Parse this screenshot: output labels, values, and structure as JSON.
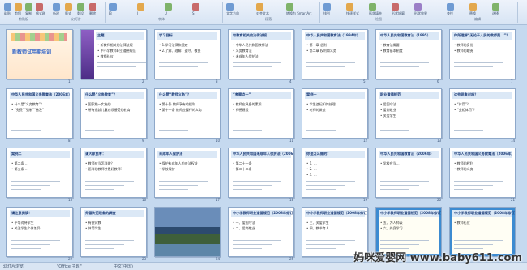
{
  "ribbon": {
    "groups": [
      {
        "label": "剪贴板",
        "buttons": [
          "粘贴",
          "剪切",
          "复制",
          "格式刷"
        ]
      },
      {
        "label": "幻灯片",
        "buttons": [
          "新建",
          "版式",
          "重设",
          "删除"
        ]
      },
      {
        "label": "字体",
        "buttons": [
          "B",
          "I",
          "U",
          "S"
        ]
      },
      {
        "label": "段落",
        "buttons": [
          "文字方向",
          "对齐文本",
          "转换为 SmartArt"
        ]
      },
      {
        "label": "绘图",
        "buttons": [
          "排列",
          "快速样式",
          "形状填充",
          "形状轮廓",
          "形状效果"
        ]
      },
      {
        "label": "编辑",
        "buttons": [
          "查找",
          "替换",
          "选择"
        ]
      }
    ]
  },
  "slides": [
    {
      "n": 1,
      "title": "新教师试用期培训",
      "type": "cover"
    },
    {
      "n": 2,
      "title": "主题",
      "bullets": [
        "新教师相关的法律法规",
        "中小学教师职业道德规范",
        "教师礼仪"
      ],
      "type": "purple"
    },
    {
      "n": 3,
      "title": "学习目标",
      "bullets": [
        "1.学习法律和规定",
        "2.了解、理解、遵守、敬畏"
      ]
    },
    {
      "n": 4,
      "title": "和教育相关的法律法规",
      "bullets": [
        "中华人民共和国教师法",
        "义务教育法",
        "未成年人保护法"
      ]
    },
    {
      "n": 5,
      "title": "中华人民共和国教育法（1994年）",
      "bullets": [
        "第一章 总则",
        "第二章 权利和义务"
      ]
    },
    {
      "n": 6,
      "title": "中华人民共和国教育法（1995）",
      "bullets": [
        "教育法概要",
        "教育基本制度"
      ]
    },
    {
      "n": 7,
      "title": "你所理解“无论于人民的教师是…”？",
      "bullets": [
        "教师的身份",
        "教师的职责"
      ]
    },
    {
      "n": 8,
      "title": "中华人民共和国义务教育法（2006年）",
      "bullets": [
        "什么是“义务教育”？",
        "“免费”“强制”“普及”"
      ]
    },
    {
      "n": 9,
      "title": "什么是“义务教育”？",
      "bullets": [
        "国家统一实施的",
        "所有适龄儿童必须接受的教育"
      ]
    },
    {
      "n": 10,
      "title": "什么是“教师义务”？",
      "bullets": [
        "第十条 教师享有的权利",
        "第十一条 教师应履行的义务"
      ]
    },
    {
      "n": 11,
      "title": "“考察点一”",
      "bullets": [
        "教师应具备的素质",
        "师德建设"
      ]
    },
    {
      "n": 12,
      "title": "案例一",
      "bullets": [
        "学生违纪如何处理",
        "老师的做法"
      ]
    },
    {
      "n": 13,
      "title": "职业道德规范",
      "bullets": [
        "爱国守法",
        "爱岗敬业",
        "关爱学生"
      ]
    },
    {
      "n": 14,
      "title": "这些现象对吗？",
      "bullets": [
        "“体罚”？",
        "“变相体罚”？"
      ]
    },
    {
      "n": 15,
      "title": "案例二",
      "bullets": [
        "第二条 …",
        "第五条 …"
      ]
    },
    {
      "n": 16,
      "title": "请大家思考：",
      "bullets": [
        "教师应当怎样做？",
        "怎样的教师才是好教师？"
      ]
    },
    {
      "n": 17,
      "title": "未成年人保护法",
      "bullets": [
        "保护未成年人的合法权益",
        "学校保护"
      ]
    },
    {
      "n": 18,
      "title": "中华人民共和国未成年人保护法（2006年）",
      "bullets": [
        "第二十一条",
        "第二十二条"
      ]
    },
    {
      "n": 19,
      "title": "你是怎么做的？",
      "bullets": [
        "1. …",
        "2. …",
        "3. …"
      ]
    },
    {
      "n": 20,
      "title": "中华人民共和国教育法（2006年）",
      "bullets": [
        "学校应当…"
      ]
    },
    {
      "n": 21,
      "title": "中华人民共和国义务教育法（2006年）",
      "bullets": [
        "教师的权利",
        "教师的义务"
      ]
    },
    {
      "n": 22,
      "title": "请注意阅读！",
      "bullets": [
        "平等对待学生",
        "关注学生个体差异"
      ]
    },
    {
      "n": 23,
      "title": "师德失范现象的调查",
      "bullets": [
        "有偿家教",
        "体罚学生"
      ]
    },
    {
      "n": 24,
      "title": "",
      "type": "photo"
    },
    {
      "n": 25,
      "title": "中小学教师职业道德规范（2008年修订）",
      "bullets": [
        "一、爱国守法",
        "二、爱岗敬业"
      ]
    },
    {
      "n": 26,
      "title": "中小学教师职业道德规范（2008年修订）",
      "bullets": [
        "三、关爱学生",
        "四、教书育人"
      ]
    },
    {
      "n": 27,
      "title": "中小学教师职业道德规范（2008年修订）",
      "bullets": [
        "五、为人师表",
        "六、终身学习"
      ],
      "type": "blueframe"
    },
    {
      "n": 28,
      "title": "中小学教师职业道德规范（2008年修订）",
      "bullets": [
        "教师礼仪"
      ],
      "type": "blueframe"
    }
  ],
  "status": {
    "left": "幻灯片浏览",
    "theme": "\"Office 主题\"",
    "lang": "中文(中国)"
  },
  "watermark": "妈咪爱婴网 www.baby611.com"
}
